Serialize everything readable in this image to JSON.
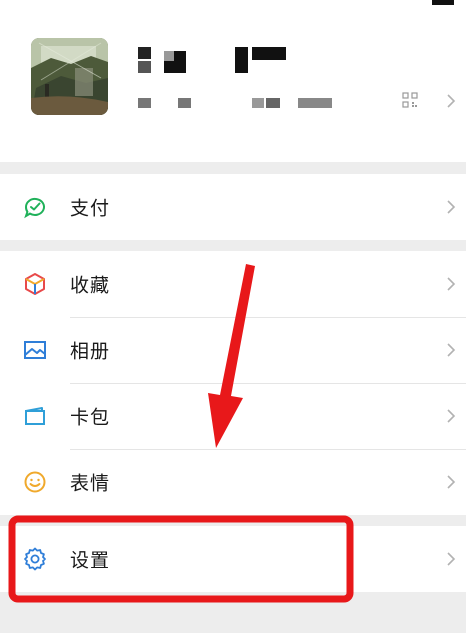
{
  "profile": {
    "avatar": "avatar-image",
    "qr_icon": "qr-code-icon",
    "chevron": "chevron-right-icon"
  },
  "menu": {
    "pay": {
      "label": "支付",
      "icon": "pay-icon"
    },
    "favorites": {
      "label": "收藏",
      "icon": "cube-icon"
    },
    "album": {
      "label": "相册",
      "icon": "image-icon"
    },
    "cards": {
      "label": "卡包",
      "icon": "wallet-icon"
    },
    "stickers": {
      "label": "表情",
      "icon": "smiley-icon"
    },
    "settings": {
      "label": "设置",
      "icon": "gear-icon"
    }
  },
  "annotation": {
    "arrow_color": "#e8181a",
    "highlight_color": "#e8181a"
  },
  "colors": {
    "pay_green": "#20b15a",
    "icon_blue": "#2f7ed8",
    "sticker_yellow": "#f0a92c",
    "background": "#ededed"
  }
}
